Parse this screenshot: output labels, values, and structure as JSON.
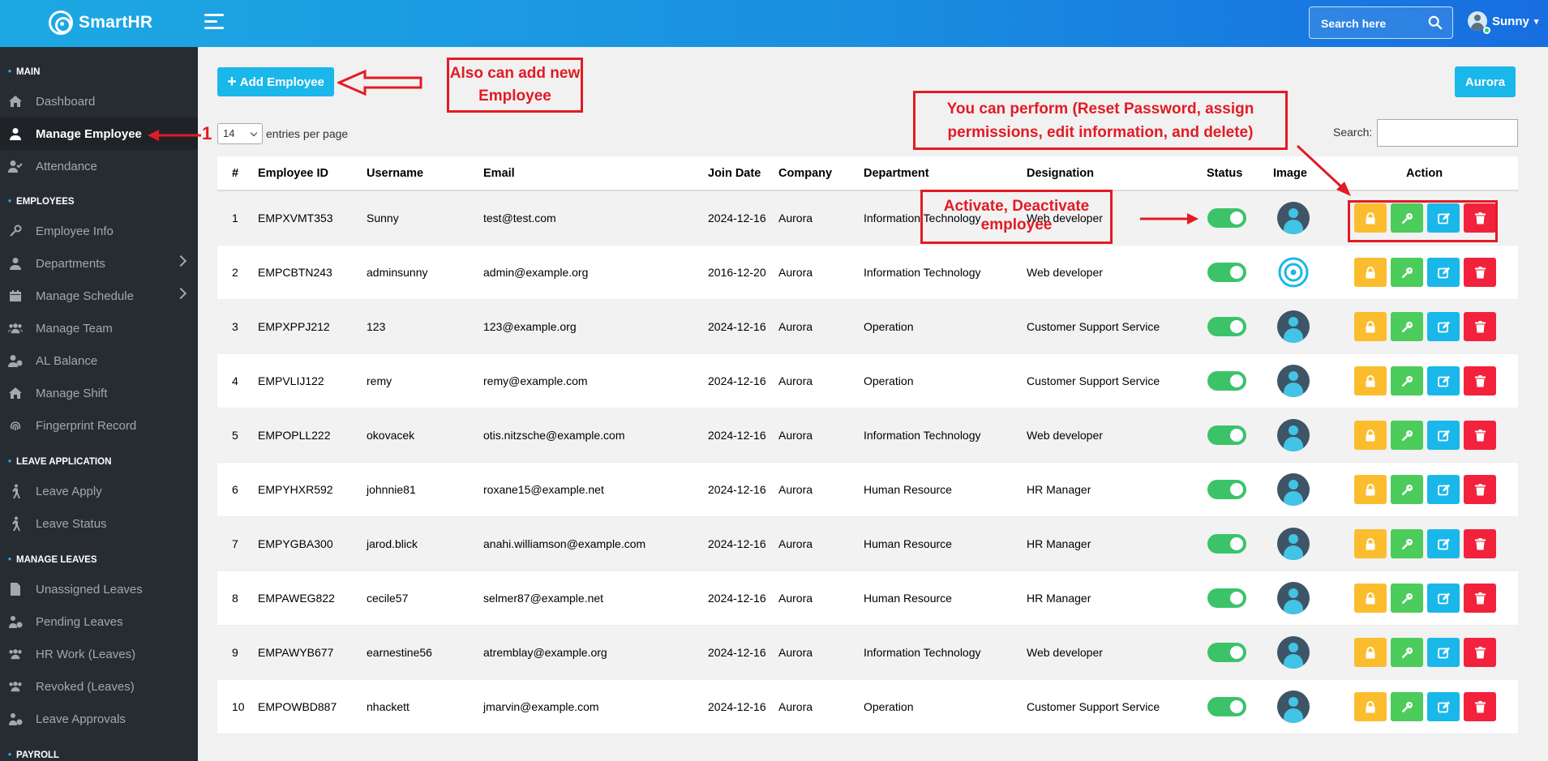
{
  "app": {
    "name": "SmartHR"
  },
  "header": {
    "search_placeholder": "Search here",
    "user_name": "Sunny"
  },
  "sidebar": {
    "sections": [
      {
        "title": "MAIN",
        "items": [
          {
            "label": "Dashboard",
            "icon": "home-icon"
          },
          {
            "label": "Manage Employee",
            "icon": "user-icon",
            "active": true
          },
          {
            "label": "Attendance",
            "icon": "user-check-icon"
          }
        ]
      },
      {
        "title": "EMPLOYEES",
        "items": [
          {
            "label": "Employee Info",
            "icon": "key-icon"
          },
          {
            "label": "Departments",
            "icon": "user-icon",
            "expandable": true
          },
          {
            "label": "Manage Schedule",
            "icon": "calendar-icon",
            "expandable": true
          },
          {
            "label": "Manage Team",
            "icon": "team-icon"
          },
          {
            "label": "AL Balance",
            "icon": "user-minus-icon"
          },
          {
            "label": "Manage Shift",
            "icon": "home-icon"
          },
          {
            "label": "Fingerprint Record",
            "icon": "fingerprint-icon"
          }
        ]
      },
      {
        "title": "LEAVE APPLICATION",
        "items": [
          {
            "label": "Leave Apply",
            "icon": "walking-icon"
          },
          {
            "label": "Leave Status",
            "icon": "walking-icon"
          }
        ]
      },
      {
        "title": "MANAGE LEAVES",
        "items": [
          {
            "label": "Unassigned Leaves",
            "icon": "file-icon"
          },
          {
            "label": "Pending Leaves",
            "icon": "user-clock-icon"
          },
          {
            "label": "HR Work (Leaves)",
            "icon": "team-icon"
          },
          {
            "label": "Revoked (Leaves)",
            "icon": "team-icon"
          },
          {
            "label": "Leave Approvals",
            "icon": "user-clock-icon"
          }
        ]
      },
      {
        "title": "PAYROLL",
        "items": []
      }
    ]
  },
  "toolbar": {
    "add_label": "Add Employee",
    "company_label": "Aurora",
    "entries_value": "14",
    "entries_suffix": "entries per page",
    "search_label": "Search:"
  },
  "table": {
    "columns": [
      "#",
      "Employee ID",
      "Username",
      "Email",
      "Join Date",
      "Company",
      "Department",
      "Designation",
      "Status",
      "Image",
      "Action"
    ],
    "rows": [
      {
        "num": "1",
        "id": "EMPXVMT353",
        "username": "Sunny",
        "email": "test@test.com",
        "join": "2024-12-16",
        "company": "Aurora",
        "dept": "Information Technology",
        "desig": "Web developer"
      },
      {
        "num": "2",
        "id": "EMPCBTN243",
        "username": "adminsunny",
        "email": "admin@example.org",
        "join": "2016-12-20",
        "company": "Aurora",
        "dept": "Information Technology",
        "desig": "Web developer"
      },
      {
        "num": "3",
        "id": "EMPXPPJ212",
        "username": "123",
        "email": "123@example.org",
        "join": "2024-12-16",
        "company": "Aurora",
        "dept": "Operation",
        "desig": "Customer Support Service"
      },
      {
        "num": "4",
        "id": "EMPVLIJ122",
        "username": "remy",
        "email": "remy@example.com",
        "join": "2024-12-16",
        "company": "Aurora",
        "dept": "Operation",
        "desig": "Customer Support Service"
      },
      {
        "num": "5",
        "id": "EMPOPLL222",
        "username": "okovacek",
        "email": "otis.nitzsche@example.com",
        "join": "2024-12-16",
        "company": "Aurora",
        "dept": "Information Technology",
        "desig": "Web developer"
      },
      {
        "num": "6",
        "id": "EMPYHXR592",
        "username": "johnnie81",
        "email": "roxane15@example.net",
        "join": "2024-12-16",
        "company": "Aurora",
        "dept": "Human Resource",
        "desig": "HR Manager"
      },
      {
        "num": "7",
        "id": "EMPYGBA300",
        "username": "jarod.blick",
        "email": "anahi.williamson@example.com",
        "join": "2024-12-16",
        "company": "Aurora",
        "dept": "Human Resource",
        "desig": "HR Manager"
      },
      {
        "num": "8",
        "id": "EMPAWEG822",
        "username": "cecile57",
        "email": "selmer87@example.net",
        "join": "2024-12-16",
        "company": "Aurora",
        "dept": "Human Resource",
        "desig": "HR Manager"
      },
      {
        "num": "9",
        "id": "EMPAWYB677",
        "username": "earnestine56",
        "email": "atremblay@example.org",
        "join": "2024-12-16",
        "company": "Aurora",
        "dept": "Information Technology",
        "desig": "Web developer"
      },
      {
        "num": "10",
        "id": "EMPOWBD887",
        "username": "nhackett",
        "email": "jmarvin@example.com",
        "join": "2024-12-16",
        "company": "Aurora",
        "dept": "Operation",
        "desig": "Customer Support Service"
      }
    ]
  },
  "annotations": {
    "step_number": "1",
    "add_note": "Also can add new Employee",
    "actions_note": "You can perform (Reset Password, assign permissions, edit information, and delete)",
    "status_note": "Activate, Deactivate employee"
  },
  "colors": {
    "primary": "#1ab7ea",
    "sidebar": "#272c33",
    "lock": "#fbbd2e",
    "key": "#4ccc5a",
    "edit": "#1ab7ea",
    "delete": "#f2223d",
    "annotation": "#e21b24"
  }
}
